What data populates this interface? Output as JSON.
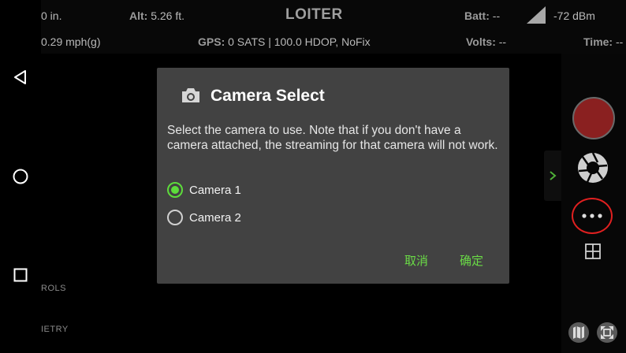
{
  "telemetry": {
    "altitude_partial": "0 in.",
    "alt_label": "Alt:",
    "alt_value": "5.26 ft.",
    "mode": "LOITER",
    "batt_label": "Batt:",
    "batt_value": "--",
    "signal": "-72 dBm",
    "speed_partial": "0.29 mph(g)",
    "gps_label": "GPS:",
    "gps_value": "0 SATS | 100.0 HDOP, NoFix",
    "volts_label": "Volts:",
    "volts_value": "--",
    "time_label": "Time:",
    "time_value": "--"
  },
  "side_labels": {
    "controls": "ROLS",
    "telemetry": "IETRY"
  },
  "dialog": {
    "title": "Camera Select",
    "message": "Select the camera to use. Note that if you don't have a camera attached, the streaming for that camera will not work.",
    "options": [
      {
        "label": "Camera 1",
        "selected": true
      },
      {
        "label": "Camera 2",
        "selected": false
      }
    ],
    "cancel": "取消",
    "ok": "确定"
  },
  "colors": {
    "accent": "#5ddc3b",
    "record": "#8a2020",
    "highlight_ring": "#e02020"
  },
  "icons": [
    "back-icon",
    "home-icon",
    "recents-icon",
    "signal-icon",
    "camera-icon",
    "record-icon",
    "shutter-icon",
    "more-icon",
    "grid-icon",
    "map-icon",
    "fullscreen-icon",
    "chevron-right-icon"
  ]
}
